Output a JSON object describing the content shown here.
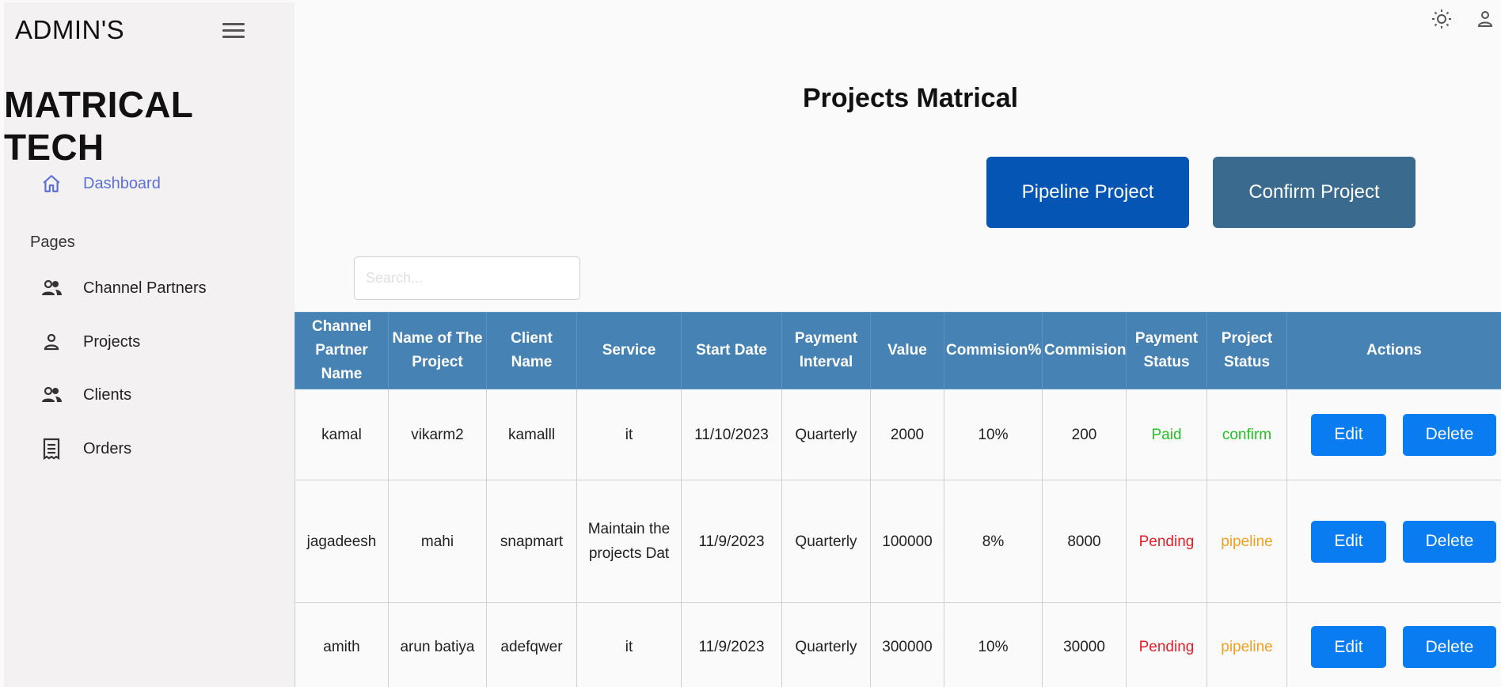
{
  "sidebar": {
    "admin_label": "ADMIN'S",
    "brand": "MATRICAL TECH",
    "nav": {
      "dashboard": "Dashboard"
    },
    "pages_label": "Pages",
    "items": [
      {
        "label": "Channel Partners",
        "icon": "users-icon"
      },
      {
        "label": "Projects",
        "icon": "user-icon"
      },
      {
        "label": "Clients",
        "icon": "users-icon"
      },
      {
        "label": "Orders",
        "icon": "receipt-icon"
      }
    ]
  },
  "header": {
    "theme_icon": "sun-icon",
    "profile_icon": "user-icon"
  },
  "main": {
    "title": "Projects Matrical",
    "pipeline_button": "Pipeline Project",
    "confirm_button": "Confirm Project",
    "search_placeholder": "Search..."
  },
  "table": {
    "headers": [
      "Channel Partner Name",
      "Name of The Project",
      "Client Name",
      "Service",
      "Start Date",
      "Payment Interval",
      "Value",
      "Commision%",
      "Commision",
      "Payment Status",
      "Project Status",
      "Actions"
    ],
    "rows": [
      {
        "partner": "kamal",
        "project": "vikarm2",
        "client": "kamalll",
        "service": "it",
        "start": "11/10/2023",
        "interval": "Quarterly",
        "value": "2000",
        "pct": "10%",
        "commission": "200",
        "payment": "Paid",
        "status": "confirm"
      },
      {
        "partner": "jagadeesh",
        "project": "mahi",
        "client": "snapmart",
        "service": "Maintain the projects Dat",
        "start": "11/9/2023",
        "interval": "Quarterly",
        "value": "100000",
        "pct": "8%",
        "commission": "8000",
        "payment": "Pending",
        "status": "pipeline"
      },
      {
        "partner": "amith",
        "project": "arun batiya",
        "client": "adefqwer",
        "service": "it",
        "start": "11/9/2023",
        "interval": "Quarterly",
        "value": "300000",
        "pct": "10%",
        "commission": "30000",
        "payment": "Pending",
        "status": "pipeline"
      }
    ],
    "edit_label": "Edit",
    "delete_label": "Delete"
  },
  "colors": {
    "sidebar_bg": "#f3f1f2",
    "active_nav": "#5b6fd6",
    "table_header": "#4682b4",
    "pipeline_button": "#0455b4",
    "confirm_button": "#3b6a8f",
    "action_button": "#0a7cf2",
    "paid": "#22c222",
    "pending": "#e0202a",
    "pipeline": "#f0a020"
  }
}
